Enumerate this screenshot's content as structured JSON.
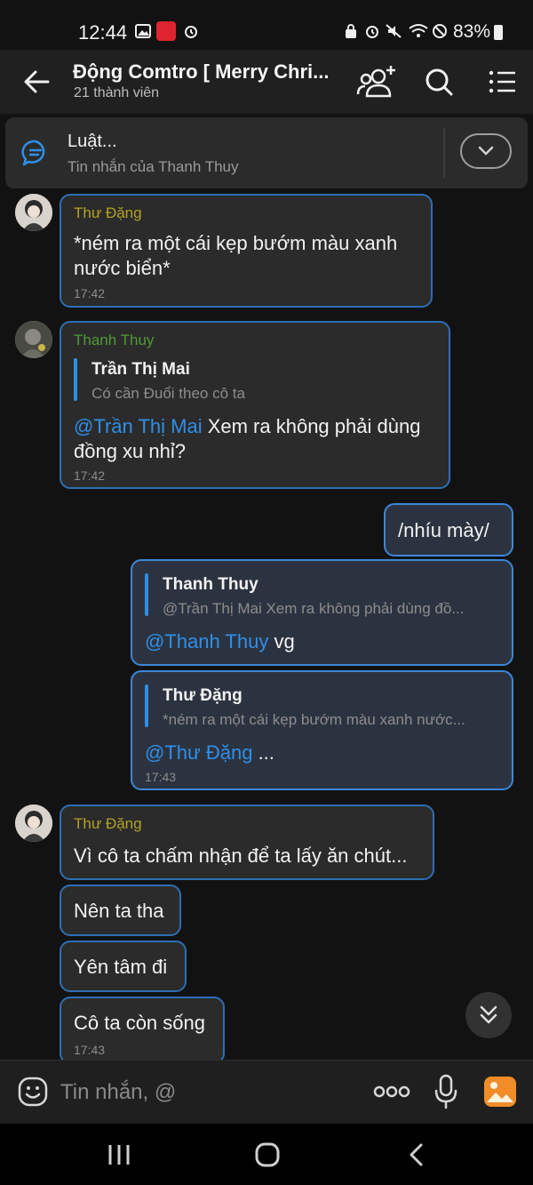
{
  "status": {
    "time": "12:44",
    "battery": "83%"
  },
  "header": {
    "title": "Động Comtro [ Merry Chri...",
    "subtitle": "21 thành viên"
  },
  "pinned": {
    "title": "Luật...",
    "subtitle": "Tin nhắn của Thanh Thuy"
  },
  "messages": {
    "m1": {
      "sender": "Thư Đặng",
      "text1": "*ném ra một cái kẹp bướm màu xanh",
      "text2": "nước biển*",
      "time": "17:42"
    },
    "m2": {
      "sender": "Thanh Thuy",
      "quote_name": "Trần Thị Mai",
      "quote_text": "Có cần Đuổi theo cô ta",
      "mention": "@Trần Thị Mai",
      "text1": " Xem ra không phải dùng",
      "text2": "đồng xu nhỉ?",
      "time": "17:42"
    },
    "m3": {
      "text": "/nhíu mày/"
    },
    "m4": {
      "quote_name": "Thanh Thuy",
      "quote_text": "@Trần Thị Mai Xem ra không phải dùng đồ...",
      "mention": "@Thanh Thuy",
      "text": " vg"
    },
    "m5": {
      "quote_name": "Thư Đặng",
      "quote_text": "*ném ra một cái kẹp bướm màu xanh nước...",
      "mention": "@Thư Đặng",
      "text": " ...",
      "time": "17:43"
    },
    "m6": {
      "sender": "Thư Đặng",
      "text": "Vì cô ta chấm nhận để ta lấy ăn chút..."
    },
    "m7": {
      "text": "Nên ta tha"
    },
    "m8": {
      "text": "Yên tâm đi"
    },
    "m9": {
      "text": "Cô ta còn sống",
      "time": "17:43"
    }
  },
  "input": {
    "placeholder": "Tin nhắn, @"
  },
  "colors": {
    "accent": "#2f8fe8",
    "bubble_border": "#2d6fb3",
    "background": "#121212",
    "sender_gold": "#b4a226",
    "sender_green": "#4f9a36"
  },
  "icons": [
    "back-arrow",
    "add-member",
    "search",
    "menu-list",
    "chat-bubble",
    "chevron-down",
    "emoji",
    "more-dots",
    "microphone",
    "gallery",
    "nav-recents",
    "nav-home",
    "nav-back"
  ]
}
